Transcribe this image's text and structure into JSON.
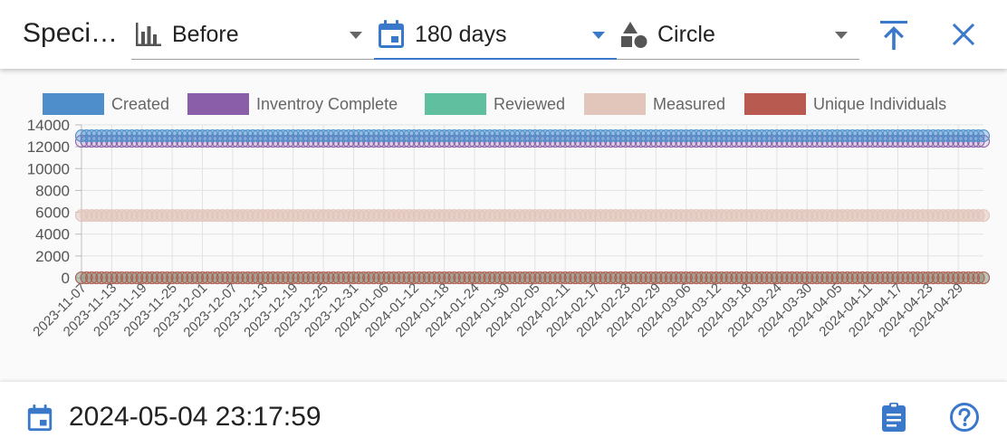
{
  "header": {
    "title": "Speci…",
    "groupby_select": {
      "value": "Before",
      "icon": "bar-chart-icon"
    },
    "range_select": {
      "value": "180 days",
      "icon": "calendar-icon"
    },
    "shape_select": {
      "value": "Circle",
      "icon": "shapes-icon"
    },
    "collapse_icon": "vertical-align-top-icon",
    "close_icon": "close-icon"
  },
  "footer": {
    "timestamp": "2024-05-04 23:17:59",
    "calendar_icon": "calendar-icon",
    "clipboard_icon": "clipboard-icon",
    "help_icon": "help-circle-icon"
  },
  "colors": {
    "accent": "#3a78c9"
  },
  "chart_data": {
    "type": "scatter",
    "marker": "circle",
    "grid": true,
    "legend_position": "top",
    "xlabel": "",
    "ylabel": "",
    "ylim": [
      0,
      14000
    ],
    "yticks": [
      0,
      2000,
      4000,
      6000,
      8000,
      10000,
      12000,
      14000
    ],
    "x_range": [
      "2023-11-07",
      "2024-05-04"
    ],
    "xticks": [
      "2023-11-07",
      "2023-11-13",
      "2023-11-19",
      "2023-11-25",
      "2023-12-01",
      "2023-12-07",
      "2023-12-13",
      "2023-12-19",
      "2023-12-25",
      "2023-12-31",
      "2024-01-06",
      "2024-01-12",
      "2024-01-18",
      "2024-01-24",
      "2024-01-30",
      "2024-02-05",
      "2024-02-11",
      "2024-02-17",
      "2024-02-23",
      "2024-02-29",
      "2024-03-06",
      "2024-03-12",
      "2024-03-18",
      "2024-03-24",
      "2024-03-30",
      "2024-04-05",
      "2024-04-11",
      "2024-04-17",
      "2024-04-23",
      "2024-04-29"
    ],
    "series": [
      {
        "name": "Created",
        "color": "#4e8fcb",
        "fill": "rgba(78,143,203,0.35)",
        "values_by_segment": [
          {
            "from": "2023-11-07",
            "to": "2024-05-04",
            "y": 13000
          }
        ]
      },
      {
        "name": "Inventroy Complete",
        "color": "#8a5ea8",
        "fill": "rgba(138,94,168,0.15)",
        "values_by_segment": [
          {
            "from": "2023-11-07",
            "to": "2024-05-04",
            "y": 12500
          }
        ]
      },
      {
        "name": "Reviewed",
        "color": "#5fbf9f",
        "fill": "rgba(95,191,159,0.4)",
        "values_by_segment": [
          {
            "from": "2023-11-07",
            "to": "2024-05-04",
            "y": 0
          }
        ]
      },
      {
        "name": "Measured",
        "color": "#e2c5bb",
        "fill": "rgba(226,197,187,0.55)",
        "values_by_segment": [
          {
            "from": "2023-11-07",
            "to": "2024-05-04",
            "y": 5700
          }
        ]
      },
      {
        "name": "Unique Individuals",
        "color": "#b85a50",
        "fill": "rgba(184,90,80,0.2)",
        "values_by_segment": [
          {
            "from": "2023-11-07",
            "to": "2024-05-04",
            "y": 0
          }
        ]
      }
    ]
  }
}
